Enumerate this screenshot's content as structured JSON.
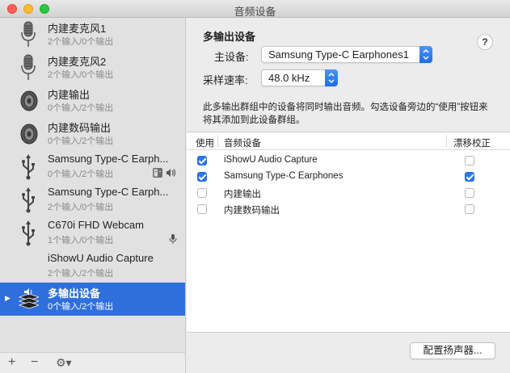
{
  "window": {
    "title": "音频设备"
  },
  "sidebar": {
    "devices": [
      {
        "name": "内建麦克风1",
        "io": "2个输入/0个输出",
        "icon": "microphone-icon"
      },
      {
        "name": "内建麦克风2",
        "io": "2个输入/0个输出",
        "icon": "microphone-icon"
      },
      {
        "name": "内建输出",
        "io": "0个输入/2个输出",
        "icon": "speaker-icon"
      },
      {
        "name": "内建数码输出",
        "io": "0个输入/2个输出",
        "icon": "speaker-icon"
      },
      {
        "name": "Samsung Type-C Earph...",
        "io": "0个输入/2个输出",
        "icon": "usb-icon",
        "badges": [
          "finder-icon",
          "speaker-small-icon"
        ]
      },
      {
        "name": "Samsung Type-C Earph...",
        "io": "2个输入/0个输出",
        "icon": "usb-icon"
      },
      {
        "name": "C670i FHD Webcam",
        "io": "1个输入/0个输出",
        "icon": "usb-icon",
        "badges": [
          "mic-small-icon"
        ]
      },
      {
        "name": "iShowU Audio Capture",
        "io": "2个输入/2个输出",
        "icon": "none"
      },
      {
        "name": "多输出设备",
        "io": "0个输入/2个输出",
        "icon": "multi-output-icon",
        "selected": true
      }
    ],
    "footer": {
      "add": "+",
      "remove": "−",
      "gear": "⚙▾"
    }
  },
  "main": {
    "heading": "多输出设备",
    "help": "?",
    "master_label": "主设备:",
    "master_value": "Samsung Type-C Earphones1",
    "rate_label": "采样速率:",
    "rate_value": "48.0 kHz",
    "description": "此多输出群组中的设备将同时输出音频。勾选设备旁边的“使用”按钮来将其添加到此设备群组。",
    "table": {
      "headers": {
        "use": "使用",
        "device": "音频设备",
        "drift": "漂移校正"
      },
      "rows": [
        {
          "use": true,
          "name": "iShowU Audio Capture",
          "drift": false
        },
        {
          "use": true,
          "name": "Samsung Type-C Earphones",
          "drift": true
        },
        {
          "use": false,
          "name": "内建输出",
          "drift": false
        },
        {
          "use": false,
          "name": "内建数码输出",
          "drift": false
        }
      ]
    },
    "configure_button": "配置扬声器..."
  },
  "colors": {
    "selection": "#2f6fdc",
    "checkbox_on": "#2b78f0"
  }
}
